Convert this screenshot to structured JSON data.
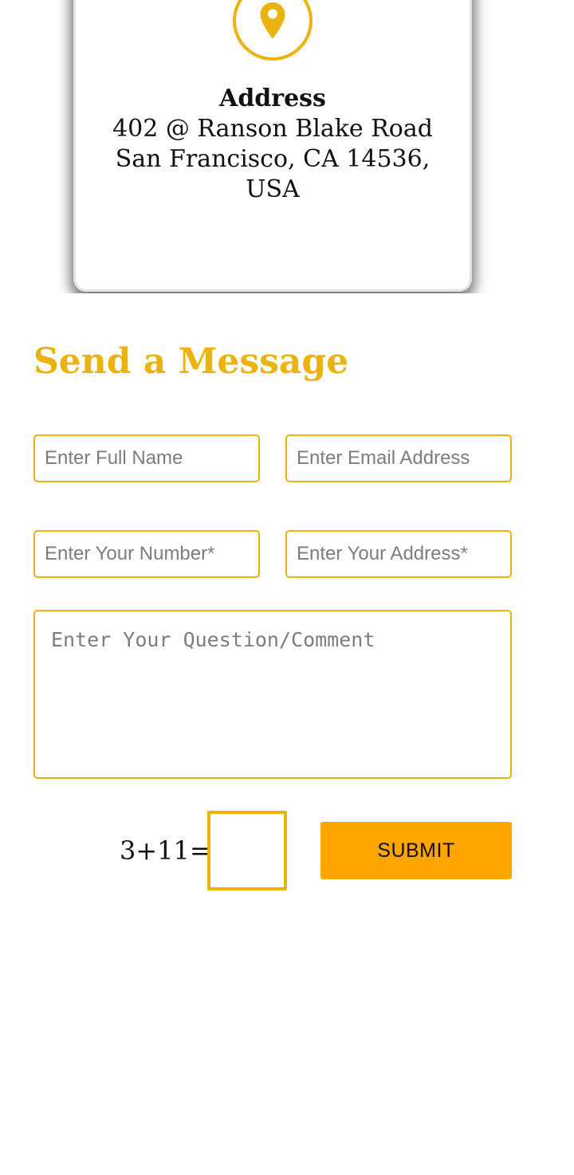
{
  "address_card": {
    "icon": "map-pin-icon",
    "title": "Address",
    "lines": [
      "402 @ Ranson Blake Road",
      "San Francisco, CA 14536,",
      "USA"
    ]
  },
  "contact_form": {
    "title": "Send a Message",
    "full_name": {
      "value": "",
      "placeholder": "Enter Full Name"
    },
    "email": {
      "value": "",
      "placeholder": "Enter Email Address"
    },
    "number": {
      "value": "",
      "placeholder": "Enter Your Number*"
    },
    "address": {
      "value": "",
      "placeholder": "Enter Your Address*"
    },
    "comment": {
      "value": "",
      "placeholder": "Enter Your Question/Comment"
    },
    "captcha": {
      "question": "3+11=",
      "value": ""
    },
    "submit_label": "SUBMIT"
  },
  "colors": {
    "accent": "#ebb30f",
    "button": "#ffa500",
    "text": "#111111",
    "placeholder": "#7d7d7d"
  }
}
